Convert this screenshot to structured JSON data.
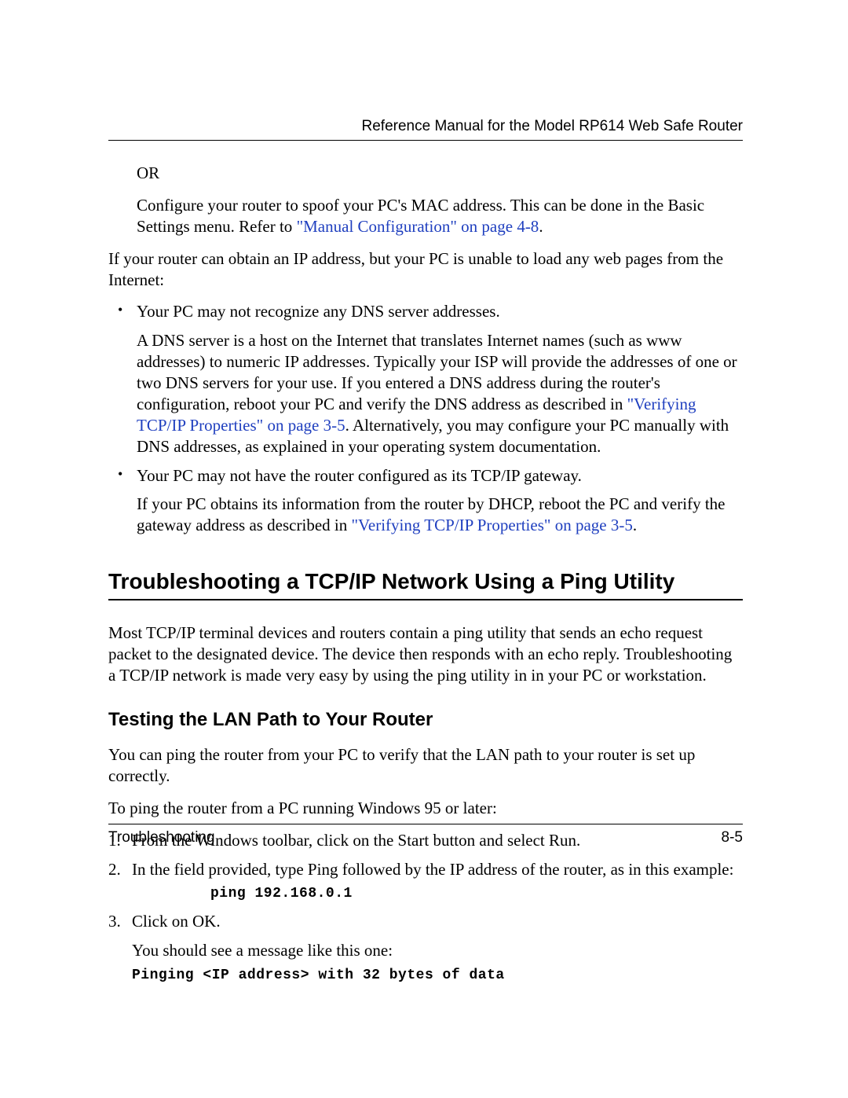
{
  "header": {
    "title": "Reference Manual for the Model RP614 Web Safe Router"
  },
  "content": {
    "or_label": "OR",
    "spoof_text_pre": "Configure your router to spoof your PC's MAC address. This can be done in the Basic Settings menu. Refer to ",
    "spoof_link": "\"Manual Configuration\" on page 4-8",
    "spoof_text_post": ".",
    "ip_intro": "If your router can obtain an IP address, but your PC is unable to load any web pages from the Internet:",
    "bullet1_lead": "Your PC may not recognize any DNS server addresses.",
    "bullet1_body_pre": "A DNS server is a host on the Internet that translates Internet names (such as www addresses) to numeric IP addresses. Typically your ISP will provide the addresses of one or two DNS servers for your use. If you entered a DNS address during the router's configuration, reboot your PC and verify the DNS address as described in ",
    "bullet1_link": "\"Verifying TCP/IP Properties\" on page 3-5",
    "bullet1_body_post": ". Alternatively, you may configure your PC manually with DNS addresses, as explained in your operating system documentation.",
    "bullet2_lead": "Your PC may not have the router configured as its TCP/IP gateway.",
    "bullet2_body_pre": "If your PC obtains its information from the router by DHCP, reboot the PC and verify the gateway address as described in ",
    "bullet2_link": "\"Verifying TCP/IP Properties\" on page 3-5",
    "bullet2_body_post": ".",
    "h1": "Troubleshooting a TCP/IP Network Using a Ping Utility",
    "h1_para": "Most TCP/IP terminal devices and routers contain a ping utility that sends an echo request packet to the designated device. The device then responds with an echo reply. Troubleshooting a TCP/IP network is made very easy by using the ping utility in in your PC or workstation.",
    "h2": "Testing the LAN Path to Your Router",
    "h2_para1": "You can ping the router from your PC to verify that the LAN path to your router is set up correctly.",
    "h2_para2": "To ping the router from a PC running Windows 95 or later:",
    "steps": {
      "s1": "From the Windows toolbar, click on the Start button and select Run.",
      "s2": "In the field provided, type Ping followed by the IP address of the router, as in this example:",
      "s2_code": "ping 192.168.0.1",
      "s3": "Click on OK.",
      "s3_body": "You should see a message like this one:",
      "s3_code": "Pinging <IP address> with 32 bytes of data"
    }
  },
  "footer": {
    "section": "Troubleshooting",
    "page": "8-5"
  }
}
